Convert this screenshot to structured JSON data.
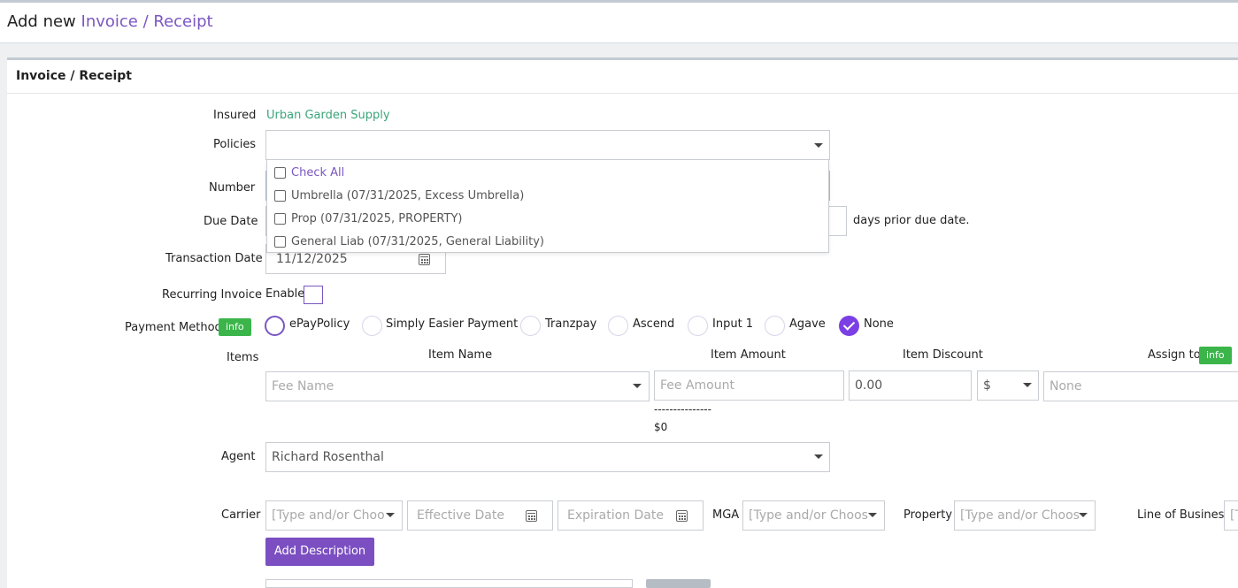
{
  "header": {
    "title_prefix": "Add new",
    "title_accent": "Invoice / Receipt"
  },
  "panel": {
    "title": "Invoice / Receipt"
  },
  "labels": {
    "insured": "Insured",
    "policies": "Policies",
    "number": "Number",
    "due_date": "Due Date",
    "transaction_date": "Transaction Date",
    "recurring_invoice": "Recurring Invoice",
    "payment_method": "Payment Method",
    "items": "Items",
    "agent": "Agent",
    "carrier": "Carrier",
    "mga": "MGA",
    "property": "Property",
    "line_of_business": "Line of Business"
  },
  "insured_name": "Urban Garden Supply",
  "policies_dropdown": {
    "check_all": "Check All",
    "options": [
      "Umbrella (07/31/2025, Excess Umbrella)",
      "Prop (07/31/2025, PROPERTY)",
      "General Liab (07/31/2025, General Liability)"
    ]
  },
  "due_date_suffix": "days prior due date.",
  "transaction_date_value": "11/12/2025",
  "recurring": {
    "enable_label": "Enable"
  },
  "info_label": "info",
  "payment_methods": [
    "ePayPolicy",
    "Simply Easier Payment",
    "Tranzpay",
    "Ascend",
    "Input 1",
    "Agave",
    "None"
  ],
  "payment_selected": "None",
  "items_table": {
    "headers": {
      "name": "Item Name",
      "amount": "Item Amount",
      "discount": "Item Discount",
      "assign": "Assign to"
    },
    "fee_name_placeholder": "Fee Name",
    "fee_amount_placeholder": "Fee Amount",
    "discount_value": "0.00",
    "discount_type": "$",
    "assign_value": "None",
    "dashes": "---------------",
    "total": "$0"
  },
  "agent_value": "Richard Rosenthal",
  "carrier_placeholder": "[Type and/or Choo",
  "effective_date_placeholder": "Effective Date",
  "expiration_date_placeholder": "Expiration Date",
  "mga_placeholder": "[Type and/or Choos",
  "property_placeholder": "[Type and/or Choos",
  "lob_placeholder": "[T",
  "add_description_label": "Add Description",
  "colors": {
    "accent": "#7b56c2",
    "insured_link": "#3aa57a",
    "info_badge": "#3bb54a",
    "button": "#7b4fc1"
  }
}
